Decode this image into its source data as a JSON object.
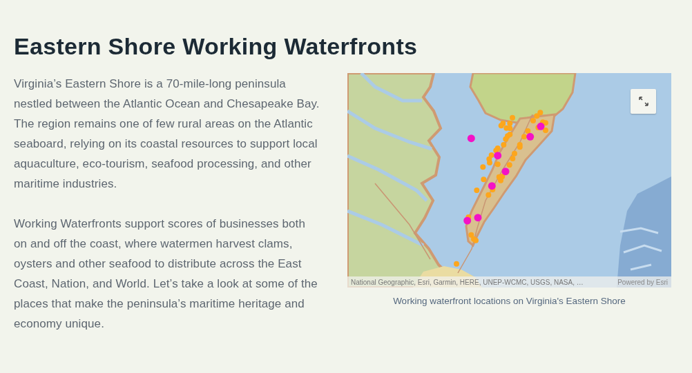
{
  "article": {
    "title": "Eastern Shore Working Waterfronts",
    "paragraphs": [
      "Virginia’s Eastern Shore is a 70-mile-long peninsula nestled between the Atlantic Ocean and Chesapeake Bay. The region remains one of few rural areas on the Atlantic seaboard, relying on its coastal resources to support local aquaculture, eco-tourism, seafood processing, and other maritime industries.",
      "Working Waterfronts support scores of businesses both on and off the coast, where watermen harvest clams, oysters and other seafood to distribute across the East Coast, Nation, and World. Let’s take a look at some of the places that make the peninsula’s maritime heritage and economy unique."
    ]
  },
  "map": {
    "attribution": "National Geographic, Esri, Garmin, HERE, UNEP-WCMC, USGS, NASA, …",
    "powered_by": "Powered by Esri",
    "caption": "Working waterfront locations on Virginia's Eastern Shore"
  }
}
